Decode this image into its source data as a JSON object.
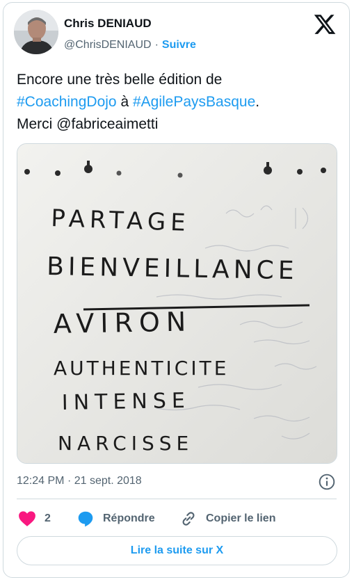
{
  "author": {
    "name": "Chris DENIAUD",
    "handle": "@ChrisDENIAUD",
    "separator": "·",
    "follow_label": "Suivre"
  },
  "tweet": {
    "text_1": "Encore une très belle édition de",
    "hashtag_1": "#CoachingDojo",
    "text_2": " à ",
    "hashtag_2": "#AgilePaysBasque",
    "text_3": ".",
    "text_4": "Merci @fabriceaimetti"
  },
  "photo": {
    "words": [
      "PARTAGE",
      "BIENVEILLANCE",
      "AVIRON",
      "AUTHENTICITE",
      "INTENSE",
      "NARCISSE"
    ]
  },
  "meta": {
    "time": "12:24 PM",
    "separator": "·",
    "date": "21 sept. 2018"
  },
  "actions": {
    "like_count": "2",
    "reply_label": "Répondre",
    "copy_link_label": "Copier le lien"
  },
  "footer": {
    "read_more_label": "Lire la suite sur X"
  },
  "colors": {
    "accent": "#1d9bf0",
    "like": "#f91880",
    "text": "#0f1419",
    "muted": "#536471",
    "border": "#cfd9de"
  },
  "icons": [
    "x-logo-icon",
    "info-icon",
    "heart-icon",
    "reply-bubble-icon",
    "link-icon"
  ]
}
